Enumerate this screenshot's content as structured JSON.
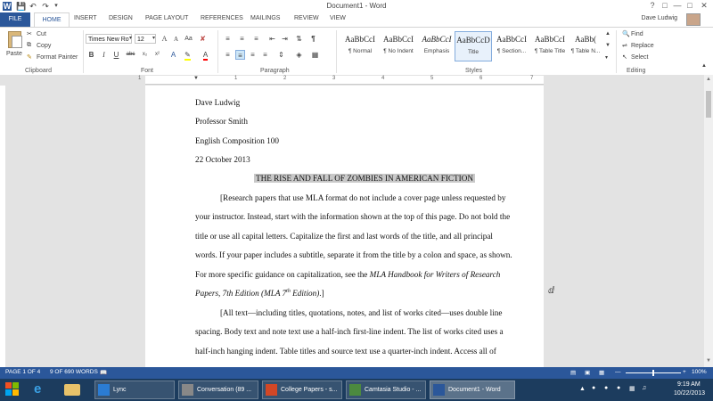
{
  "title_bar": {
    "title": "Document1 - Word"
  },
  "tabs": {
    "file": "FILE",
    "home": "HOME",
    "insert": "INSERT",
    "design": "DESIGN",
    "page_layout": "PAGE LAYOUT",
    "references": "REFERENCES",
    "mailings": "MAILINGS",
    "review": "REVIEW",
    "view": "VIEW"
  },
  "user": {
    "name": "Dave Ludwig"
  },
  "clipboard": {
    "paste": "Paste",
    "cut": "Cut",
    "copy": "Copy",
    "format_painter": "Format Painter",
    "label": "Clipboard"
  },
  "font": {
    "name": "Times New Ro",
    "size": "12",
    "label": "Font"
  },
  "paragraph": {
    "label": "Paragraph"
  },
  "styles": {
    "label": "Styles",
    "items": [
      {
        "sample": "AaBbCcI",
        "name": "¶ Normal"
      },
      {
        "sample": "AaBbCcI",
        "name": "¶ No Indent"
      },
      {
        "sample": "AaBbCcI",
        "name": "Emphasis"
      },
      {
        "sample": "AaBbCcD",
        "name": "Title"
      },
      {
        "sample": "AaBbCcI",
        "name": "¶ Section..."
      },
      {
        "sample": "AaBbCcI",
        "name": "¶ Table Title"
      },
      {
        "sample": "AaBb(",
        "name": "¶ Table N..."
      }
    ]
  },
  "editing": {
    "find": "Find",
    "replace": "Replace",
    "select": "Select",
    "label": "Editing"
  },
  "ruler": {
    "numbers": [
      "1",
      "1",
      "2",
      "3",
      "4",
      "5",
      "6",
      "7"
    ]
  },
  "document": {
    "header_lines": [
      "Dave Ludwig",
      "Professor Smith",
      "English Composition 100",
      "22 October 2013"
    ],
    "title": "THE RISE AND FALL OF ZOMBIES IN AMERICAN FICTION",
    "para1": [
      "[Research papers that use MLA format do not include a cover page unless requested by",
      "your instructor. Instead, start with the information shown at the top of this page.  Do not bold the",
      "title or use all capital letters. Capitalize the first and last words of the title, and all principal",
      "words. If your paper includes a subtitle, separate it from the title by a colon and space, as shown."
    ],
    "para1_line5_prefix": "For more specific guidance on capitalization, see the ",
    "para1_line5_italic": "MLA Handbook for Writers of Research",
    "para1_line6_italic_a": "Papers, 7th Edition (MLA 7",
    "para1_line6_sup": "th",
    "para1_line6_italic_b": " Edition)",
    "para1_line6_end": ".]",
    "para2": [
      "[All text—including titles, quotations, notes, and list of works cited—uses double line",
      "spacing. Body text and note text use a half-inch first-line indent. The list of works cited uses a",
      "half-inch hanging indent. Table titles and source text use a quarter-inch indent. Access all of"
    ]
  },
  "status": {
    "page": "PAGE 1 OF 4",
    "words": "9 OF 690 WORDS",
    "zoom": "100%"
  },
  "taskbar": {
    "items": [
      "Lync",
      "Conversation (89 ...",
      "College Papers - s...",
      "Camtasia Studio - ...",
      "Document1 - Word"
    ],
    "time": "9:19 AM",
    "date": "10/22/2013"
  },
  "colors": {
    "accent": "#2b579a",
    "taskbar": "#1c3c5e",
    "highlight": "#c8c8c8"
  }
}
